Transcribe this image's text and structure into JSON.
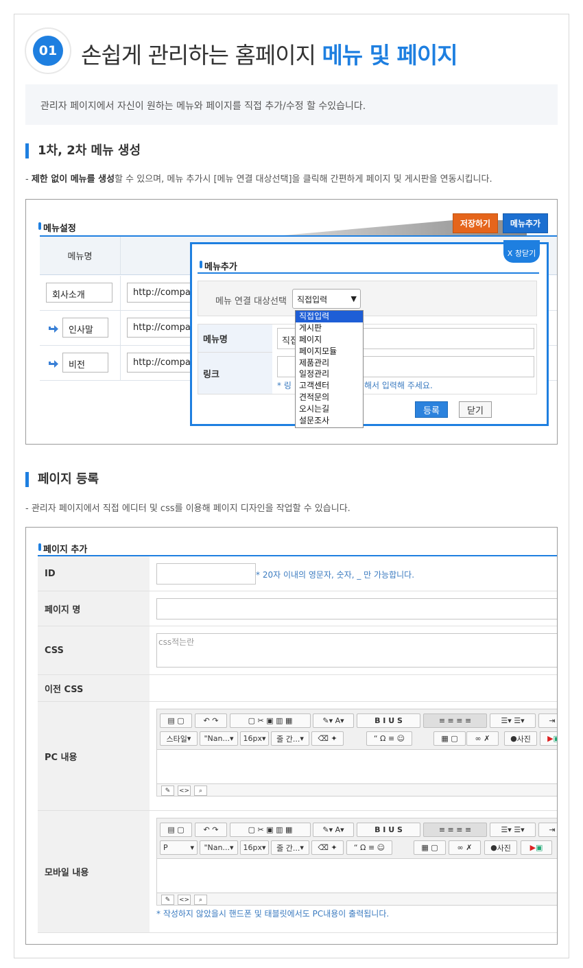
{
  "header": {
    "number": "01",
    "title_plain": "손쉽게 관리하는  홈페이지 ",
    "title_highlight": "메뉴 및 페이지",
    "description": "관리자 페이지에서 자신이 원하는 메뉴와 페이지를 직접 추가/수정 할 수있습니다.",
    "accent_color": "#1e7fe0"
  },
  "section1": {
    "title": "1차, 2차 메뉴 생성",
    "desc_prefix": "- ",
    "desc_bold": "제한 없이 메뉴를 생성",
    "desc_rest": "할 수 있으며, 메뉴 추가시 [메뉴 연결 대상선택]을 클릭해 간편하게 페이지 및 게시판을 연동시킵니다.",
    "panel_title": "메뉴설정",
    "save_button": "저장하기",
    "add_menu_button": "메뉴추가",
    "col_menu_name": "메뉴명",
    "rows": [
      {
        "name": "회사소개",
        "link": "http://compan"
      },
      {
        "name": "인사말",
        "link": "http://compan"
      },
      {
        "name": "비전",
        "link": "http://compan"
      }
    ],
    "popup": {
      "close_label": "X 창닫기",
      "title": "메뉴추가",
      "select_label": "메뉴 연결 대상선택",
      "select_value": "직접입력",
      "field_menu_name": "메뉴명",
      "field_menu_value": "직접",
      "field_link": "링크",
      "hint_star": "* 링",
      "hint_tail": "해서 입력해 주세요.",
      "register_button": "등록",
      "close_button": "닫기",
      "options": [
        "직접입력",
        "게시판",
        "페이지",
        "페이지모듈",
        "제품관리",
        "일정관리",
        "고객센터",
        "견적문의",
        "오시는길",
        "설문조사"
      ]
    }
  },
  "section2": {
    "title": "페이지 등록",
    "desc": "- 관리자 페이지에서 직접 에디터 및 css를 이용해 페이지 디자인을 작업할 수 있습니다.",
    "panel_title": "페이지 추가",
    "label_id": "ID",
    "id_hint": "* 20자 이내의 영문자, 숫자, _ 만 가능합니다.",
    "label_page_name": "페이지 명",
    "label_css": "CSS",
    "css_placeholder": "css적는란",
    "label_prev_css": "이전 CSS",
    "label_pc": "PC 내용",
    "label_mobile": "모바일 내용",
    "mobile_hint": "* 작성하지 않았을시 핸드폰 및 태블릿에서도 PC내용이 출력됩니다.",
    "editor_pc": {
      "style": "스타일",
      "font": "\"Nan...",
      "size": "16px",
      "line": "줄 간...",
      "photo": "사진"
    },
    "editor_mobile": {
      "style": "P",
      "font": "\"Nan...",
      "size": "16px",
      "line": "줄 간...",
      "photo": "사진"
    }
  }
}
